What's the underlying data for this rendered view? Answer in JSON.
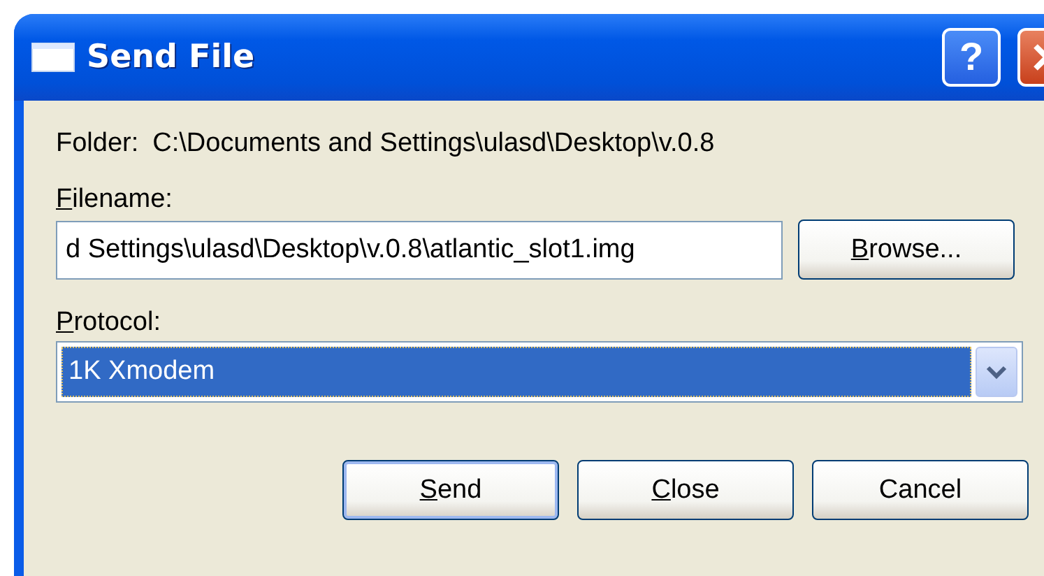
{
  "window": {
    "title": "Send File",
    "title_buttons": [
      {
        "kind": "help",
        "label": "?"
      },
      {
        "kind": "close"
      }
    ]
  },
  "folder": {
    "label": "Folder:",
    "value": "C:\\Documents and Settings\\ulasd\\Desktop\\v.0.8"
  },
  "filename": {
    "label": "Filename:",
    "mnemonic": true,
    "value": "d Settings\\ulasd\\Desktop\\v.0.8\\atlantic_slot1.img"
  },
  "browse_button": {
    "label": "Browse...",
    "mnemonic": true
  },
  "protocol": {
    "label": "Protocol:",
    "mnemonic": true,
    "value": "1K Xmodem",
    "focused": true
  },
  "buttons": [
    {
      "label": "Send",
      "mnemonic": true,
      "default": true
    },
    {
      "label": "Close",
      "mnemonic": true,
      "default": false
    },
    {
      "label": "Cancel",
      "mnemonic": false,
      "default": false
    }
  ]
}
